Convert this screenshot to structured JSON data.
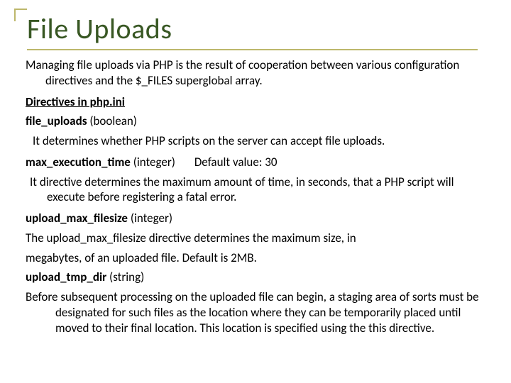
{
  "title": "File Uploads",
  "intro": "Managing file uploads via PHP is the result of cooperation between various configuration directives and the $_FILES superglobal array.",
  "section": "Directives in php.ini",
  "d1": {
    "name": "file_uploads",
    "type": "(boolean)",
    "desc": "It determines whether PHP scripts on the server can accept file uploads."
  },
  "d2": {
    "name": "max_execution_time",
    "type": "(integer)",
    "default": "Default value: 30",
    "desc": "It directive determines the maximum amount of  time, in seconds, that a PHP script will execute before registering a  fatal error."
  },
  "d3": {
    "name": "upload_max_filesize",
    "type": "(integer)",
    "desc1": "The upload_max_filesize directive determines the maximum size, in",
    "desc2": "megabytes, of an uploaded file. Default is 2MB."
  },
  "d4": {
    "name": "upload_tmp_dir",
    "type": "(string)",
    "desc": "Before subsequent  processing on the uploaded file can begin, a staging area  of sorts must be designated for  such files as the location where they can be  temporarily placed until moved to their final location. This location is specified using the this directive."
  }
}
